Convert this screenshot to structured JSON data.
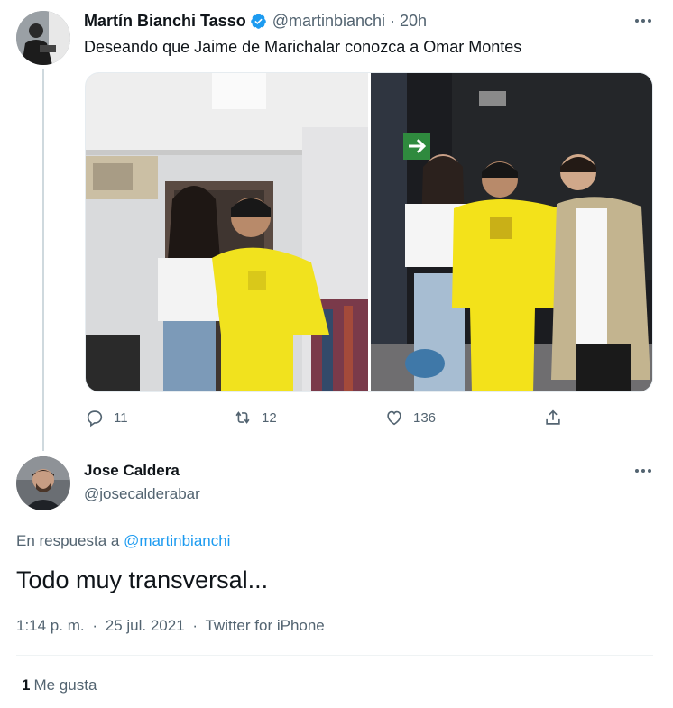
{
  "tweet": {
    "display_name": "Martín Bianchi Tasso",
    "handle": "@martinbianchi",
    "separator": "·",
    "time": "20h",
    "text": "Deseando que Jaime de Marichalar conozca a Omar Montes",
    "images": [
      "photo-backstage-room",
      "photo-event-green-exit"
    ],
    "actions": {
      "replies": "11",
      "retweets": "12",
      "likes": "136"
    }
  },
  "reply": {
    "display_name": "Jose Caldera",
    "handle": "@josecalderabar",
    "in_reply_prefix": "En respuesta a",
    "in_reply_handle": "@martinbianchi",
    "text": "Todo muy transversal...",
    "time": "1:14 p. m.",
    "dot": "·",
    "date": "25 jul. 2021",
    "source": "Twitter for iPhone",
    "like_count": "1",
    "like_label": "Me gusta"
  },
  "colors": {
    "accent": "#1d9bf0",
    "secondary_text": "#536471",
    "primary_text": "#0f1419",
    "divider": "#eff3f4"
  }
}
